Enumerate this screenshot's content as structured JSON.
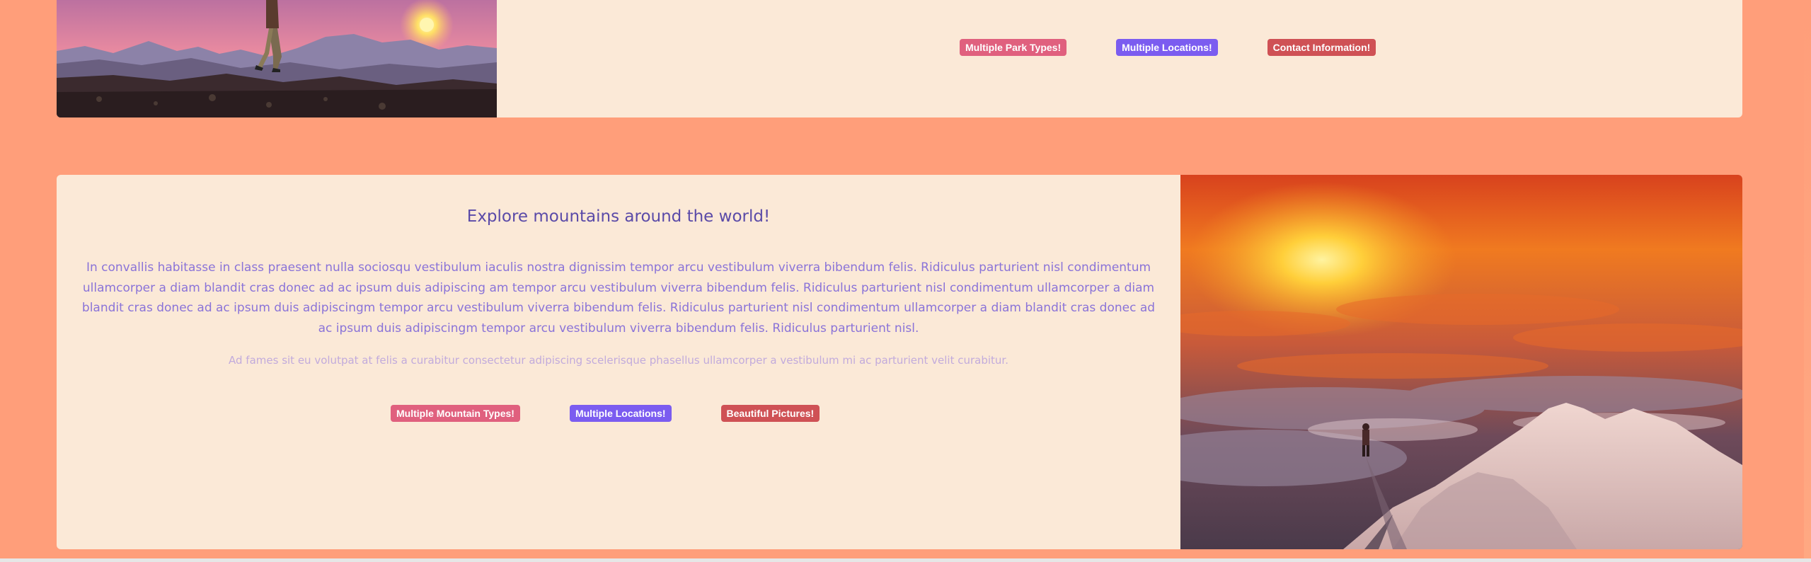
{
  "top_section": {
    "badges": [
      {
        "label": "Multiple Park Types!",
        "color": "#e0607e"
      },
      {
        "label": "Multiple Locations!",
        "color": "#7b5cf0"
      },
      {
        "label": "Contact Information!",
        "color": "#cf5155"
      }
    ]
  },
  "mountain_section": {
    "title": "Explore mountains around the world!",
    "body": "In convallis habitasse in class praesent nulla sociosqu vestibulum iaculis nostra dignissim tempor arcu vestibulum viverra bibendum felis. Ridiculus parturient nisl condimentum ullamcorper a diam blandit cras donec ad ac ipsum duis adipiscing am tempor arcu vestibulum viverra bibendum felis. Ridiculus parturient nisl condimentum ullamcorper a diam blandit cras donec ad ac ipsum duis adipiscingm tempor arcu vestibulum viverra bibendum felis. Ridiculus parturient nisl condimentum ullamcorper a diam blandit cras donec ad ac ipsum duis adipiscingm tempor arcu vestibulum viverra bibendum felis. Ridiculus parturient nisl.",
    "lead": "Ad fames sit eu volutpat at felis a curabitur consectetur adipiscing scelerisque phasellus ullamcorper a vestibulum mi ac parturient velit curabitur.",
    "badges": [
      {
        "label": "Multiple Mountain Types!",
        "color": "#e0607e"
      },
      {
        "label": "Multiple Locations!",
        "color": "#7b5cf0"
      },
      {
        "label": "Beautiful Pictures!",
        "color": "#cf5155"
      }
    ]
  },
  "colors": {
    "page_background": "#ff9e7a",
    "card_background": "#fbe9d7",
    "heading": "#5a4aa8",
    "body_text": "#8a73d8",
    "lead_text": "#c2abdc"
  },
  "icons": {
    "top_image": "hiker-at-sunset-image",
    "bottom_image": "mountain-summit-sunset-image"
  }
}
